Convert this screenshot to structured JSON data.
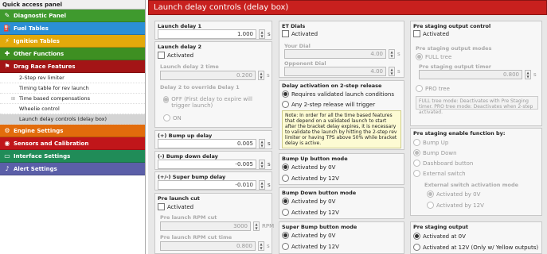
{
  "sidebar": {
    "title": "Quick access panel",
    "items": [
      {
        "label": "Diagnostic Panel",
        "color": "#3f9a2e",
        "icon": "wrench-icon"
      },
      {
        "label": "Fuel Tables",
        "color": "#2b8fd6",
        "icon": "fuel-nozzle-icon"
      },
      {
        "label": "Ignition Tables",
        "color": "#e3a90b",
        "icon": "spark-icon"
      },
      {
        "label": "Other Functions",
        "color": "#3e8f22",
        "icon": "puzzle-icon"
      },
      {
        "label": "Drag Race Features",
        "color": "#a31516",
        "icon": "flag-icon"
      }
    ],
    "sub_items": [
      {
        "label": "2-Step rev limiter",
        "tree": ""
      },
      {
        "label": "Timing table for rev launch",
        "tree": ""
      },
      {
        "label": "Time based compensations",
        "tree": "⊞"
      },
      {
        "label": "Wheelie control",
        "tree": ""
      },
      {
        "label": "Launch delay controls (delay box)",
        "tree": ""
      }
    ],
    "items2": [
      {
        "label": "Engine Settings",
        "color": "#e26c0c",
        "icon": "engine-icon"
      },
      {
        "label": "Sensors and Calibration",
        "color": "#c0161a",
        "icon": "sensor-icon"
      },
      {
        "label": "Interface Settings",
        "color": "#208c58",
        "icon": "monitor-icon"
      },
      {
        "label": "Alert Settings",
        "color": "#5b5fa8",
        "icon": "bell-icon"
      }
    ]
  },
  "header": {
    "title": "Launch delay controls (delay box)"
  },
  "col1": {
    "ld1": {
      "title": "Launch delay 1",
      "value": "1.000",
      "unit": "s"
    },
    "ld2": {
      "title": "Launch delay 2",
      "activated": "Activated",
      "time_label": "Launch delay 2 time",
      "time_value": "0.200",
      "unit": "s",
      "override_label": "Delay 2 to override Delay 1",
      "opt_off": "OFF (First delay to expire will trigger launch)",
      "opt_on": "ON"
    },
    "bump_up": {
      "title": "(+) Bump up delay",
      "value": "0.005",
      "unit": "s"
    },
    "bump_down": {
      "title": "(-) Bump down delay",
      "value": "-0.005",
      "unit": "s"
    },
    "super_bump": {
      "title": "(+/-) Super bump delay",
      "value": "-0.010",
      "unit": "s"
    },
    "plc": {
      "title": "Pre launch cut",
      "activated": "Activated",
      "rpm_label": "Pre launch RPM cut",
      "rpm_value": "3000",
      "rpm_unit": "RPM",
      "time_label": "Pre launch RPM cut time",
      "time_value": "0.800",
      "unit": "s"
    }
  },
  "col2": {
    "et": {
      "title": "ET Dials",
      "activated": "Activated",
      "your_label": "Your Dial",
      "your_value": "4.00",
      "opp_label": "Opponent Dial",
      "opp_value": "4.00",
      "unit": "s"
    },
    "act": {
      "title": "Delay activation on 2-step release",
      "opt1": "Requires validated launch conditions",
      "opt2": "Any 2-step release will trigger",
      "note": "Note: In order for all the time based features that depend on a validated launch to start after the bracket delay expires, it is necessary to validate the launch by hitting the 2-step rev limiter or having TPS above 50% while bracket delay is active."
    },
    "bu": {
      "title": "Bump Up button mode",
      "o1": "Activated by 0V",
      "o2": "Activated by 12V"
    },
    "bd": {
      "title": "Bump Down button mode",
      "o1": "Activated by 0V",
      "o2": "Activated by 12V"
    },
    "sb": {
      "title": "Super Bump button mode",
      "o1": "Activated by 0V",
      "o2": "Activated by 12V"
    }
  },
  "col3": {
    "psc": {
      "title": "Pre staging output control",
      "activated": "Activated",
      "modes_label": "Pre staging output modes",
      "full": "FULL tree",
      "timer_label": "Pre staging output timer",
      "timer_value": "0.800",
      "unit": "s",
      "pro": "PRO tree",
      "note": "FULL tree mode: Deactivates with Pre Staging timer. PRO tree mode: Deactivates when 2-step activated."
    },
    "pse": {
      "title": "Pre staging enable function by:",
      "o1": "Bump Up",
      "o2": "Bump Down",
      "o3": "Dashboard button",
      "o4": "External switch",
      "ext_label": "External switch activation mode",
      "e1": "Activated by 0V",
      "e2": "Activated by 12V"
    },
    "pso": {
      "title": "Pre staging output",
      "o1": "Activated at 0V",
      "o2": "Activated at 12V (Only w/ Yellow outputs)"
    }
  }
}
